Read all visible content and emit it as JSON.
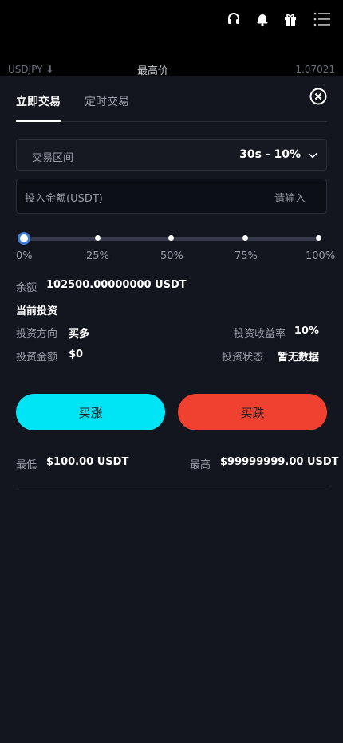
{
  "header": {
    "icons": [
      "headset-icon",
      "bell-icon",
      "gift-icon",
      "menu-icon"
    ]
  },
  "ticker": {
    "symbol": "USDJPY ⬇",
    "label": "最高价",
    "value": "1.07021"
  },
  "tabs": [
    {
      "label": "立即交易",
      "active": true
    },
    {
      "label": "定时交易",
      "active": false
    }
  ],
  "interval": {
    "label": "交易区间",
    "value": "30s - 10%"
  },
  "amount": {
    "label": "投入金额(USDT)",
    "placeholder": "请输入"
  },
  "slider": {
    "value_percent": 0,
    "marks": [
      "0%",
      "25%",
      "50%",
      "75%",
      "100%"
    ]
  },
  "balance": {
    "label": "余额",
    "value": "102500.00000000 USDT"
  },
  "current_investment": {
    "title": "当前投资",
    "direction_label": "投资方向",
    "direction_value": "买多",
    "yield_label": "投资收益率",
    "yield_value": "10%",
    "amount_label": "投资金额",
    "amount_value": "$0",
    "status_label": "投资状态",
    "status_value": "暂无数据"
  },
  "actions": {
    "buy_up": "买涨",
    "buy_down": "买跌"
  },
  "limits": {
    "min_label": "最低",
    "min_value": "$100.00 USDT",
    "max_label": "最高",
    "max_value": "$99999999.00 USDT"
  },
  "colors": {
    "buy_up": "#00e5f5",
    "buy_down": "#f0402f",
    "background": "#13151f"
  }
}
